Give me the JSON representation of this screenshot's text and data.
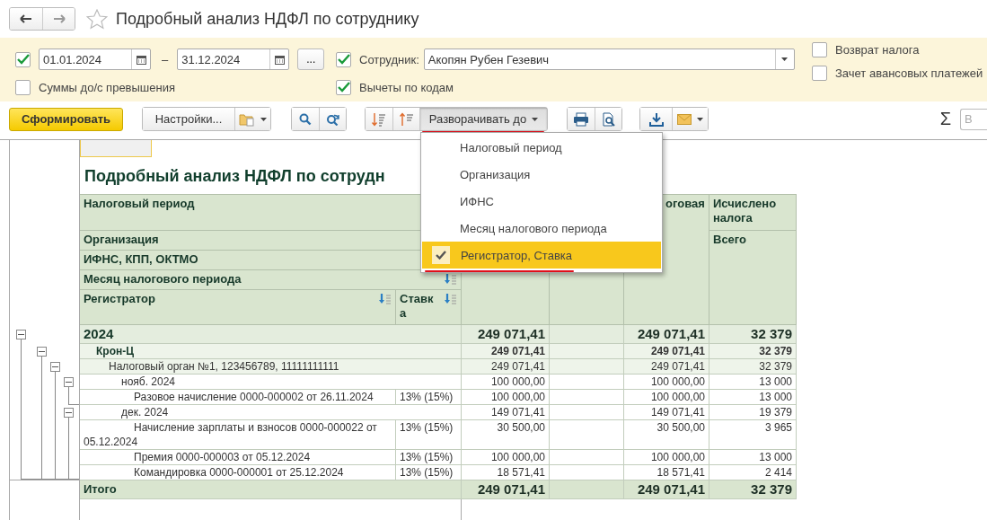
{
  "header": {
    "title": "Подробный анализ НДФЛ по сотруднику",
    "favorite": false
  },
  "filters": {
    "period": {
      "checked": true,
      "from": "01.01.2024",
      "separator": "–",
      "to": "31.12.2024",
      "button": "..."
    },
    "employee": {
      "checked": true,
      "label": "Сотрудник:",
      "value": "Акопян Рубен Гезевич"
    },
    "checks": [
      {
        "label": "Суммы до/с превышения",
        "checked": false
      },
      {
        "label": "Вычеты по кодам",
        "checked": true
      },
      {
        "label": "Возврат налога",
        "checked": false
      },
      {
        "label": "Зачет авансовых платежей",
        "checked": false
      }
    ]
  },
  "toolbar": {
    "generate": "Сформировать",
    "settings": "Настройки...",
    "expand": {
      "label": "Разворачивать до",
      "pressed": true,
      "annotated": true
    },
    "sum": "Σ",
    "search_placeholder": "В"
  },
  "expand_menu": {
    "items": [
      {
        "label": "Налоговый период",
        "selected": false,
        "annotated": false
      },
      {
        "label": "Организация",
        "selected": false,
        "annotated": false
      },
      {
        "label": "ИФНС",
        "selected": false,
        "annotated": false
      },
      {
        "label": "Месяц налогового периода",
        "selected": false,
        "annotated": false
      },
      {
        "label": "Регистратор, Ставка",
        "selected": true,
        "annotated": true
      }
    ]
  },
  "report": {
    "title": "Подробный анализ НДФЛ по сотрудн",
    "groupings": [
      "Налоговый период",
      "Организация",
      "ИФНС, КПП, ОКТМО",
      "Месяц налогового периода"
    ],
    "registrar": "Регистратор",
    "rate": "Ставка",
    "column_5": "оговая",
    "column_6": "Исчислено налога",
    "column_6_sub": "Всего",
    "rows": [
      {
        "label": "2024",
        "values": [
          "249 071,41",
          "249 071,41",
          "32 379"
        ],
        "expanded": true,
        "children": [
          {
            "label": "Крон-Ц",
            "values": [
              "249 071,41",
              "249 071,41",
              "32 379"
            ],
            "expanded": true,
            "children": [
              {
                "label": "Налоговый орган №1, 123456789, 11111111111",
                "values": [
                  "249 071,41",
                  "249 071,41",
                  "32 379"
                ],
                "expanded": true,
                "children": [
                  {
                    "label": "нояб. 2024",
                    "values": [
                      "100 000,00",
                      "100 000,00",
                      "13 000"
                    ],
                    "expanded": true,
                    "children": [
                      {
                        "label": "Разовое начисление 0000-000002 от 26.11.2024",
                        "rate": "13% (15%)",
                        "values": [
                          "100 000,00",
                          "100 000,00",
                          "13 000"
                        ]
                      }
                    ]
                  },
                  {
                    "label": "дек. 2024",
                    "values": [
                      "149 071,41",
                      "149 071,41",
                      "19 379"
                    ],
                    "expanded": true,
                    "children": [
                      {
                        "label": "Начисление зарплаты и взносов 0000-000022 от 05.12.2024",
                        "rate": "13% (15%)",
                        "values": [
                          "30 500,00",
                          "30 500,00",
                          "3 965"
                        ]
                      },
                      {
                        "label": "Премия 0000-000003 от 05.12.2024",
                        "rate": "13% (15%)",
                        "values": [
                          "100 000,00",
                          "100 000,00",
                          "13 000"
                        ]
                      },
                      {
                        "label": "Командировка 0000-000001 от 25.12.2024",
                        "rate": "13% (15%)",
                        "values": [
                          "18 571,41",
                          "18 571,41",
                          "2 414"
                        ]
                      }
                    ]
                  }
                ]
              }
            ]
          }
        ]
      }
    ],
    "total": {
      "label": "Итого",
      "values": [
        "249 071,41",
        "249 071,41",
        "32 379"
      ]
    }
  }
}
